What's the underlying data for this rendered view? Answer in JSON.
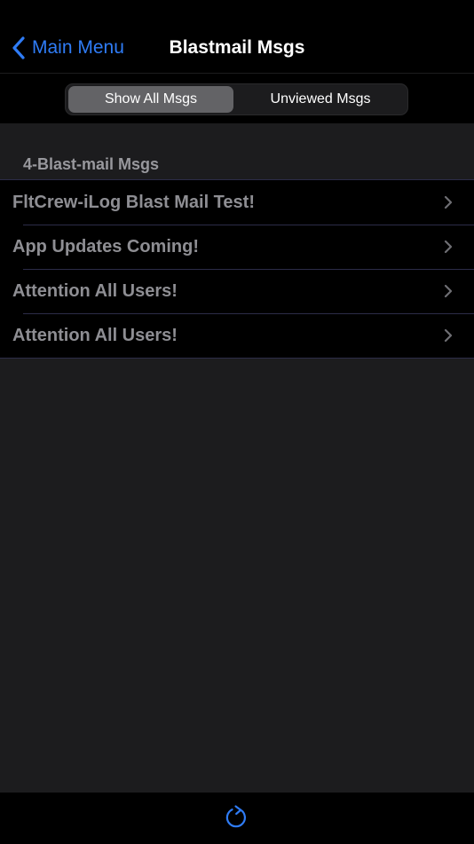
{
  "navbar": {
    "back_label": "Main Menu",
    "title": "Blastmail Msgs"
  },
  "segments": {
    "selected_label": "Show All Msgs",
    "other_label": "Unviewed Msgs"
  },
  "section": {
    "header": "4-Blast-mail Msgs",
    "items": [
      {
        "label": "FltCrew-iLog Blast Mail Test!"
      },
      {
        "label": "App Updates Coming!"
      },
      {
        "label": "Attention All Users!"
      },
      {
        "label": "Attention All Users!"
      }
    ]
  },
  "toolbar": {
    "icon": "refresh-icon"
  },
  "colors": {
    "accent": "#2f7cf6",
    "background": "#000000",
    "content_background": "#1c1c1e",
    "segment_selected": "#636366",
    "row_text": "#8e8e93"
  },
  "icons": {
    "back": "chevron-left-icon",
    "disclosure": "chevron-right-icon",
    "refresh": "refresh-icon"
  }
}
